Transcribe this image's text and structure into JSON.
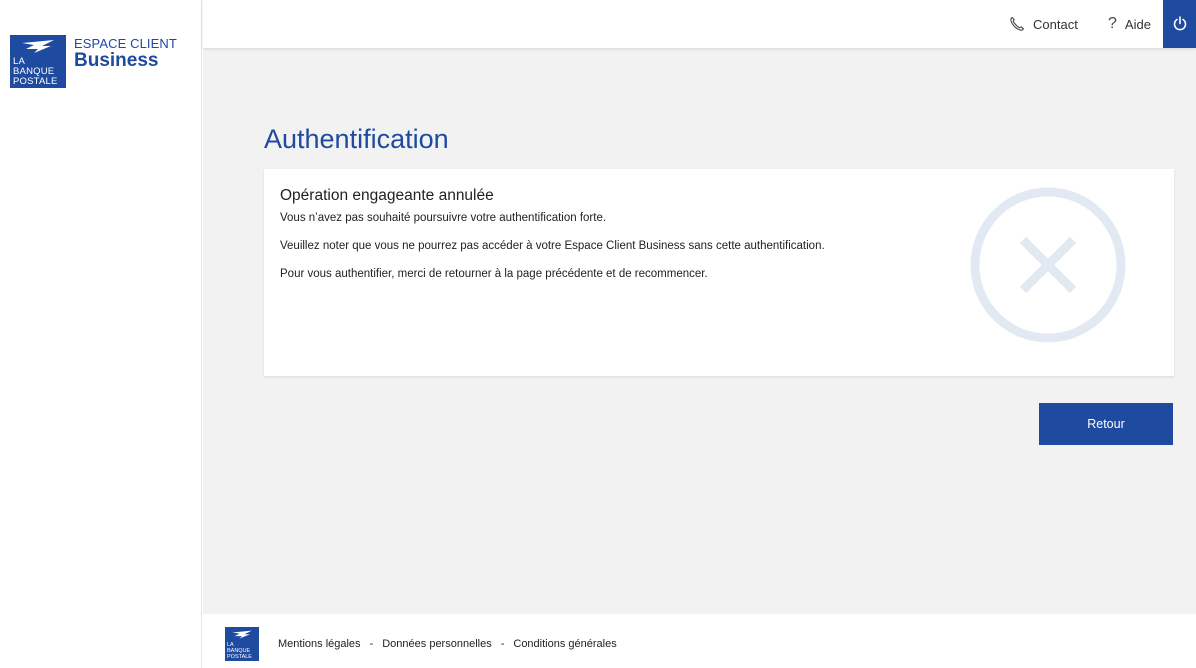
{
  "brand": {
    "logo_line1": "LA",
    "logo_line2": "BANQUE",
    "logo_line3": "POSTALE",
    "espace_client": "ESPACE CLIENT",
    "business": "Business",
    "color": "#1e4aa0"
  },
  "topbar": {
    "contact_label": "Contact",
    "contact_icon": "phone-icon",
    "aide_label": "Aide",
    "aide_icon": "question-icon",
    "logout_icon": "power-icon"
  },
  "main": {
    "title": "Authentification",
    "card": {
      "title": "Opération engageante annulée",
      "line1": "Vous n’avez pas souhaité poursuivre votre authentification forte.",
      "line2": "Veuillez noter que vous ne pourrez pas accéder à votre Espace Client Business sans cette authentification.",
      "line3": "Pour vous authentifier, merci de retourner à la page précédente et de recommencer.",
      "status_icon": "cancel-circle-icon"
    },
    "retour_label": "Retour"
  },
  "footer": {
    "mentions": "Mentions légales",
    "donnees": "Données personnelles",
    "conditions": "Conditions générales",
    "separator": "-"
  }
}
